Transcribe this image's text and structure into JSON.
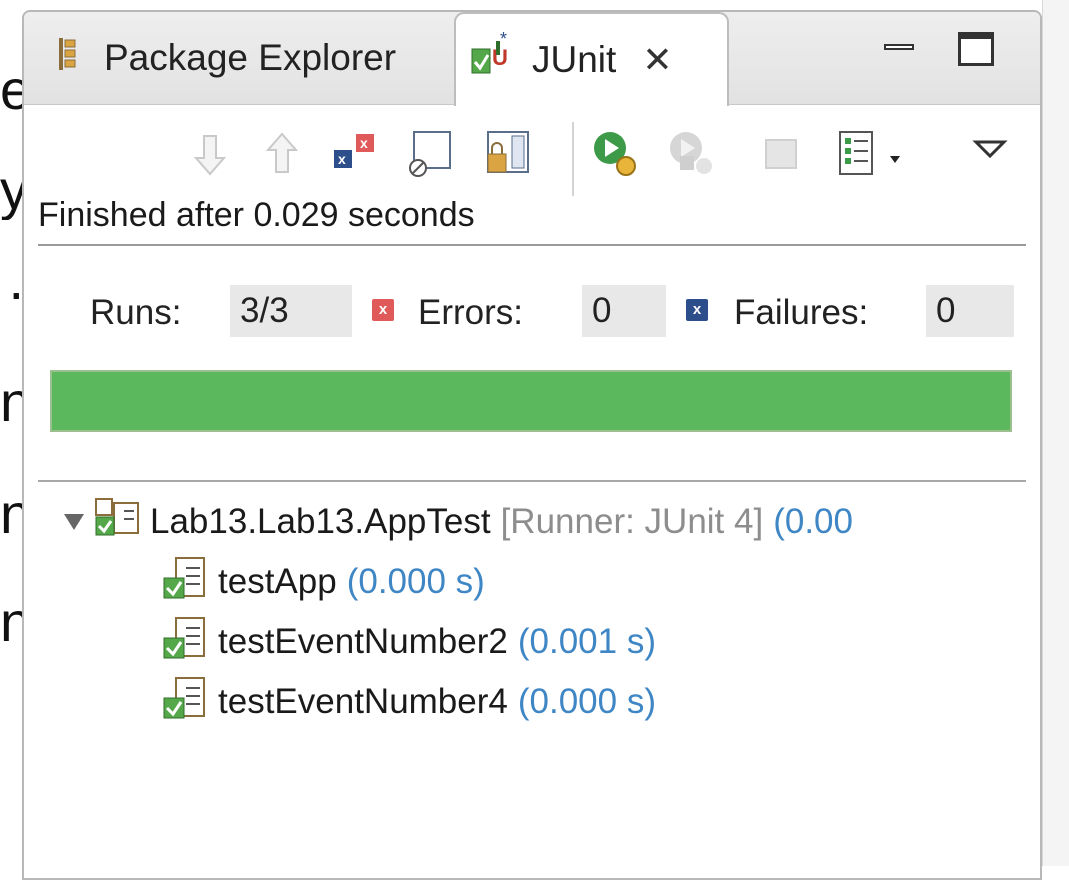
{
  "background_text": [
    "e",
    "y",
    ".",
    "n",
    "n",
    "n"
  ],
  "tabs": [
    {
      "label": "Package Explorer",
      "active": false
    },
    {
      "label": "JUnit",
      "active": true
    }
  ],
  "status": "Finished after 0.029 seconds",
  "counters": {
    "runs_label": "Runs:",
    "runs_value": "3/3",
    "errors_label": "Errors:",
    "errors_value": "0",
    "failures_label": "Failures:",
    "failures_value": "0"
  },
  "progress": {
    "fraction": 1.0,
    "color": "#5cb85c"
  },
  "tree": {
    "root": {
      "name": "Lab13.Lab13.AppTest",
      "runner": "[Runner: JUnit 4]",
      "time": "(0.00"
    },
    "children": [
      {
        "name": "testApp",
        "time": "(0.000 s)"
      },
      {
        "name": "testEventNumber2",
        "time": "(0.001 s)"
      },
      {
        "name": "testEventNumber4",
        "time": "(0.000 s)"
      }
    ]
  },
  "colors": {
    "error": "#e05a5a",
    "failure": "#2c4f8c",
    "time": "#3f86c5",
    "runner": "#8d8d8d"
  }
}
